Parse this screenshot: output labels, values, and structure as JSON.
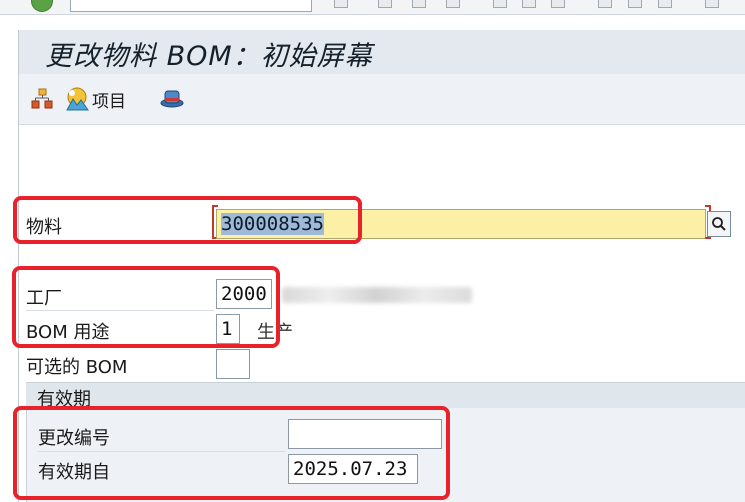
{
  "title": "更改物料 BOM：初始屏幕",
  "toolbar": {
    "items_label": "项目"
  },
  "form": {
    "material_label": "物料",
    "material_value": "300008535",
    "plant_label": "工厂",
    "plant_value": "2000",
    "bom_usage_label": "BOM 用途",
    "bom_usage_value": "1",
    "bom_usage_desc": "生产",
    "alt_bom_label": "可选的 BOM",
    "alt_bom_value": ""
  },
  "validity": {
    "section_title": "有效期",
    "change_no_label": "更改编号",
    "change_no_value": "",
    "valid_from_label": "有效期自",
    "valid_from_value": "2025.07.23"
  },
  "icons": [
    "sap-green-check-icon",
    "hierarchy-icon",
    "items-icon",
    "print-hat-icon",
    "search-help-icon"
  ],
  "colors": {
    "highlight": "#e8222b",
    "required_field": "#fbf0a6",
    "header_bg": "#e3e9ee"
  }
}
